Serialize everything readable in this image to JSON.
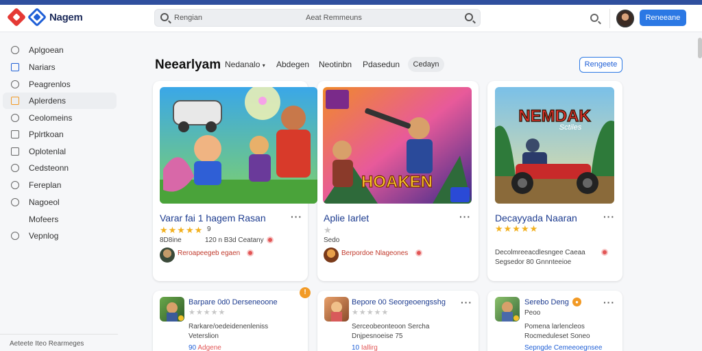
{
  "app": {
    "name": "Nagem"
  },
  "search": {
    "placeholder": "Rengian",
    "center_text": "Aeat Remmeuns"
  },
  "topbar": {
    "button_label": "Reneeane"
  },
  "sidebar": {
    "items": [
      {
        "label": "Aplgoean",
        "icon": "user-icon"
      },
      {
        "label": "Nariars",
        "icon": "card-icon"
      },
      {
        "label": "Peagrenlos",
        "icon": "tag-icon"
      },
      {
        "label": "Aplerdens",
        "icon": "grid-icon",
        "active": true
      },
      {
        "label": "Ceolomeins",
        "icon": "chat-icon"
      },
      {
        "label": "Pplrtkoan",
        "icon": "list-icon"
      },
      {
        "label": "Oplotenlal",
        "icon": "doc-icon"
      },
      {
        "label": "Cedsteonn",
        "icon": "clock-icon"
      },
      {
        "label": "Fereplan",
        "icon": "pin-icon"
      },
      {
        "label": "Nagoeol",
        "icon": "gear-icon"
      },
      {
        "label": "Mofeers",
        "icon": ""
      },
      {
        "label": "Vepnlog",
        "icon": "circle-icon"
      }
    ],
    "footer": "Aeteete Iteo Rearmeges"
  },
  "page": {
    "title": "Neearlyam",
    "tabs": [
      "Nedanalo",
      "Abdegen",
      "Neotinbn",
      "Pdasedun"
    ],
    "pill": "Cedayn",
    "button": "Rengeete"
  },
  "featured": [
    {
      "title": "Varar fai 1 hagem Rasan",
      "rating_text": "9",
      "meta1": "8D8ine",
      "meta2": "120 n B3d Ceatany",
      "dev": "Reroapeegeb egaen",
      "image": "characters-artwork",
      "stars": 5
    },
    {
      "title": "Aplie Iarlet",
      "rating_text": "",
      "meta1": "Sedo",
      "meta2": "",
      "dev": "Berpordoe Nlageones",
      "image": "shooter-artwork",
      "banner": "HOAKEN",
      "stars": 1
    },
    {
      "title": "Decayyada Naaran",
      "rating_text": "",
      "meta1": "Decolmreeacdlesngee Caeaa",
      "meta2": "Segsedor 80 Gnnnteeioe",
      "dev": "",
      "image": "atv-artwork",
      "banner": "NEMDAK",
      "banner_sub": "Sctiles",
      "stars": 5
    }
  ],
  "small_cards": [
    {
      "title": "Barpare 0d0 Derseneoone",
      "desc1": "Rarkare/oedeidenenleniss",
      "desc2": "Veterslion",
      "link": "Adgene",
      "link_prefix": "90"
    },
    {
      "title": "Bepore 00 Seorgeoengsshg",
      "desc1": "Serceobeonteoon Sercha",
      "desc2": "Dnjpesnoeise 75",
      "link": "Iallirg",
      "link_prefix": "10"
    },
    {
      "title": "Serebo Deng",
      "desc1": "Pomena larlencleos",
      "desc2": "Rocmeduleset Soneo",
      "link": "Sepngde Cemeeoegnsee",
      "sub": "Peoo"
    }
  ]
}
